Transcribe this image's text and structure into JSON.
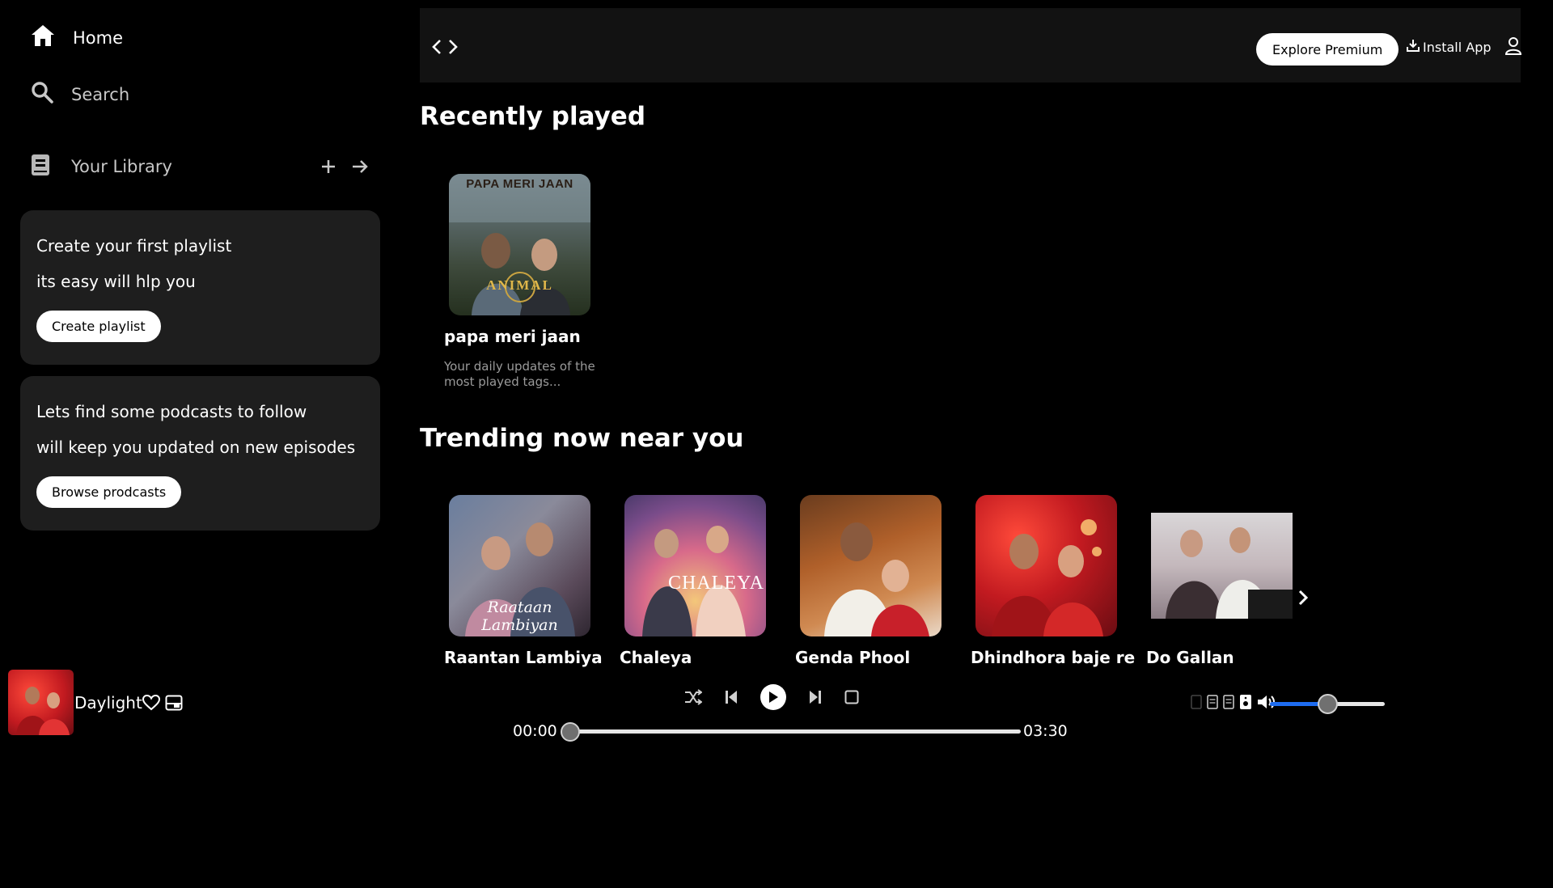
{
  "sidebar": {
    "home_label": "Home",
    "search_label": "Search",
    "library_label": "Your Library",
    "playlist_card": {
      "line1": "Create your first playlist",
      "line2": "its easy will hlp you",
      "button": "Create playlist"
    },
    "podcast_card": {
      "line1": "Lets find some podcasts to follow",
      "line2": "will keep you updated on new episodes",
      "button": "Browse prodcasts"
    }
  },
  "topbar": {
    "premium_label": "Explore Premium",
    "install_label": "Install App"
  },
  "recently_played": {
    "title": "Recently played",
    "items": [
      {
        "title": "papa meri jaan",
        "description": "Your daily updates of the most played tags...",
        "cover_text": "PAPA MERI JAAN",
        "cover_sub": "ANIMAL"
      }
    ]
  },
  "trending": {
    "title": "Trending now near you",
    "items": [
      {
        "title": "Raantan Lambiya",
        "cover_text": "Raataan Lambiyan"
      },
      {
        "title": "Chaleya",
        "cover_text": "CHALEYA"
      },
      {
        "title": "Genda Phool"
      },
      {
        "title": "Dhindhora baje re"
      },
      {
        "title": "Do Gallan"
      }
    ]
  },
  "player": {
    "track_title": "Daylight",
    "current_time": "00:00",
    "total_time": "03:30",
    "progress": 0.0,
    "volume": 0.5
  },
  "colors": {
    "background": "#000000",
    "card": "#1e1e1e",
    "topbar": "#121212",
    "volume_accent": "#1e6cf0"
  },
  "icons": [
    "home-icon",
    "search-icon",
    "library-icon",
    "plus-icon",
    "arrow-right-icon",
    "code-icon",
    "download-icon",
    "user-icon",
    "chevron-right-icon",
    "heart-icon",
    "picture-in-picture-icon",
    "shuffle-icon",
    "previous-icon",
    "play-icon",
    "next-icon",
    "repeat-icon",
    "lyrics-icon",
    "queue-icon",
    "device-icon",
    "volume-icon"
  ]
}
